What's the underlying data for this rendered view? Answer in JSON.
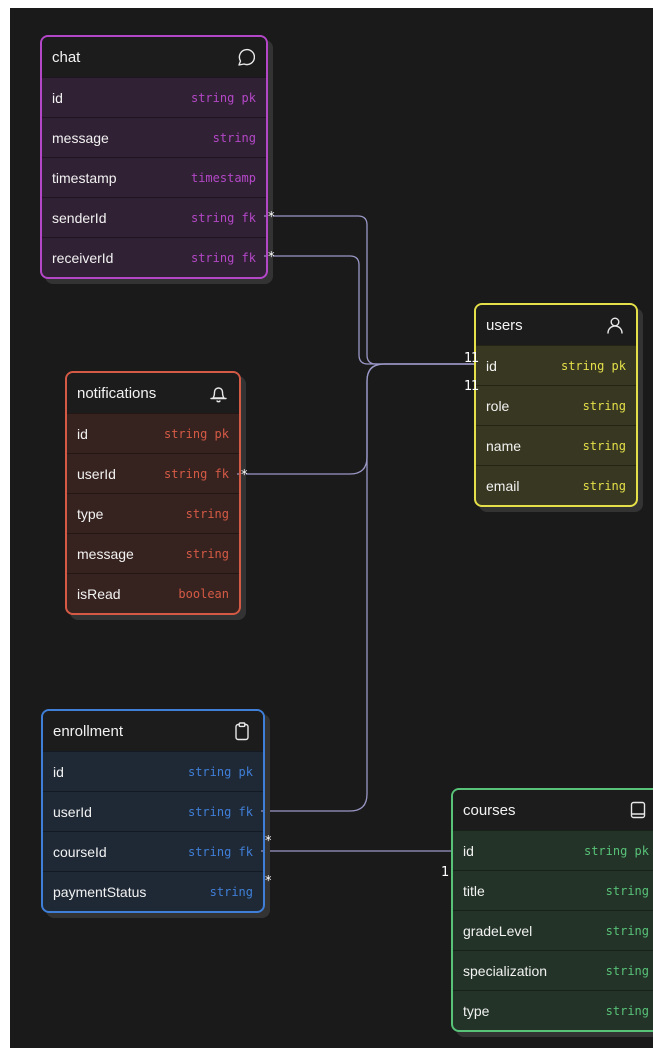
{
  "colors": {
    "canvas": "#1a1a1a",
    "connector": "#9a98c6",
    "chat": "#b447c8",
    "notifications": "#d55a45",
    "users": "#e5e04a",
    "enrollment": "#3f7fd8",
    "courses": "#58c278"
  },
  "entities": {
    "chat": {
      "title": "chat",
      "icon": "message-circle-icon",
      "fields": [
        {
          "name": "id",
          "type": "string pk"
        },
        {
          "name": "message",
          "type": "string"
        },
        {
          "name": "timestamp",
          "type": "timestamp"
        },
        {
          "name": "senderId",
          "type": "string fk"
        },
        {
          "name": "receiverId",
          "type": "string fk"
        }
      ]
    },
    "notifications": {
      "title": "notifications",
      "icon": "bell-icon",
      "fields": [
        {
          "name": "id",
          "type": "string pk"
        },
        {
          "name": "userId",
          "type": "string fk"
        },
        {
          "name": "type",
          "type": "string"
        },
        {
          "name": "message",
          "type": "string"
        },
        {
          "name": "isRead",
          "type": "boolean"
        }
      ]
    },
    "users": {
      "title": "users",
      "icon": "user-icon",
      "fields": [
        {
          "name": "id",
          "type": "string pk"
        },
        {
          "name": "role",
          "type": "string"
        },
        {
          "name": "name",
          "type": "string"
        },
        {
          "name": "email",
          "type": "string"
        }
      ]
    },
    "enrollment": {
      "title": "enrollment",
      "icon": "clipboard-icon",
      "fields": [
        {
          "name": "id",
          "type": "string pk"
        },
        {
          "name": "userId",
          "type": "string fk"
        },
        {
          "name": "courseId",
          "type": "string fk"
        },
        {
          "name": "paymentStatus",
          "type": "string"
        }
      ]
    },
    "courses": {
      "title": "courses",
      "icon": "book-icon",
      "fields": [
        {
          "name": "id",
          "type": "string pk"
        },
        {
          "name": "title",
          "type": "string"
        },
        {
          "name": "gradeLevel",
          "type": "string"
        },
        {
          "name": "specialization",
          "type": "string"
        },
        {
          "name": "type",
          "type": "string"
        }
      ]
    }
  },
  "relationships": [
    {
      "from": "chat.senderId",
      "to": "users.id",
      "from_card": "*",
      "to_card": "1"
    },
    {
      "from": "chat.receiverId",
      "to": "users.id",
      "from_card": "*",
      "to_card": "1"
    },
    {
      "from": "notifications.userId",
      "to": "users.id",
      "from_card": "*",
      "to_card": "1"
    },
    {
      "from": "enrollment.userId",
      "to": "users.id",
      "from_card": "*",
      "to_card": "1"
    },
    {
      "from": "enrollment.courseId",
      "to": "courses.id",
      "from_card": "*",
      "to_card": "1"
    }
  ]
}
